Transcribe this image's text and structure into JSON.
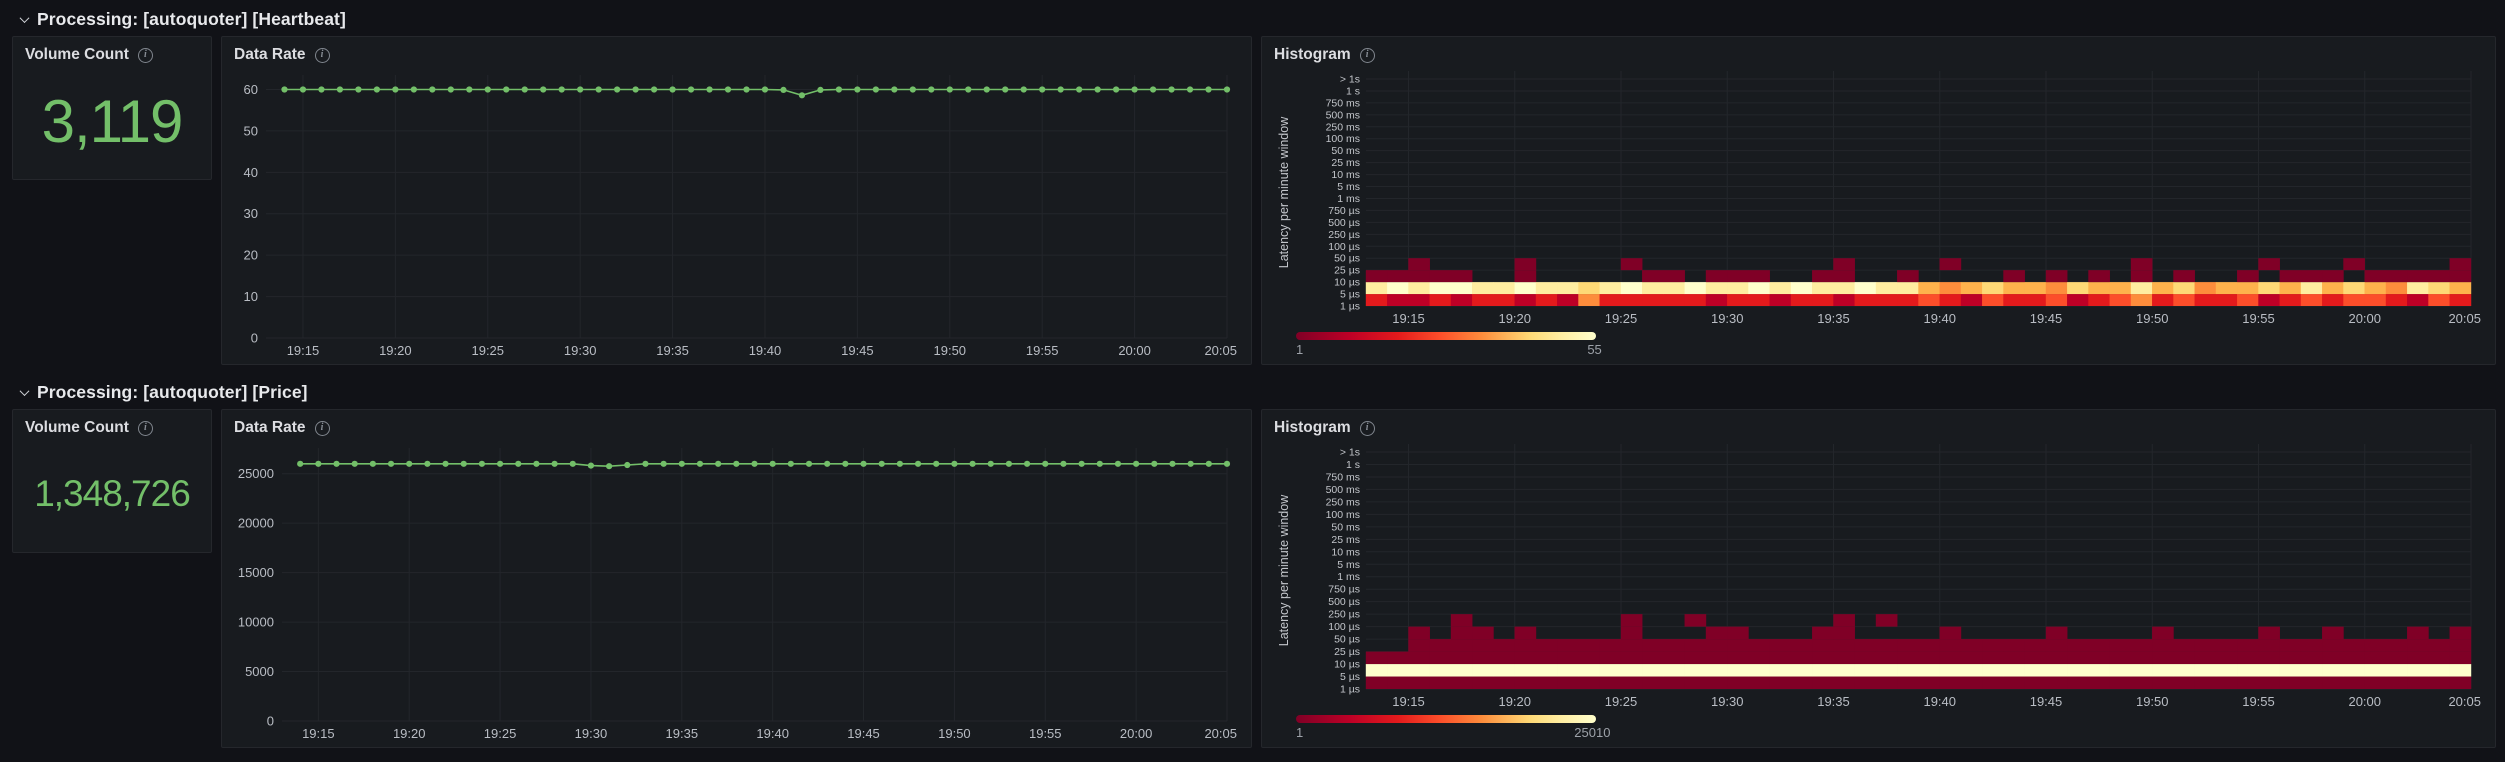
{
  "icons": {
    "row_collapse": "chevron-down",
    "panel_info": "info-circle"
  },
  "colors": {
    "page_bg": "#111217",
    "panel_bg": "#181b1f",
    "panel_border": "#25272c",
    "grid": "#23262b",
    "axis_text": "#b9bdc4",
    "bucket_text": "#c3c6cb",
    "green": "#73bf69",
    "heat_palette": [
      "#800026",
      "#bd0026",
      "#e31a1c",
      "#fc4e2a",
      "#fd8d3c",
      "#feb24c",
      "#fed976",
      "#ffeda0",
      "#ffffcc"
    ]
  },
  "rows": [
    {
      "title": "Processing: [autoquoter] [Heartbeat]",
      "stat": {
        "title": "Volume Count",
        "value": "3,119"
      },
      "rate": {
        "title": "Data Rate"
      },
      "hist": {
        "title": "Histogram",
        "legend_min": "1",
        "legend_max": "55"
      }
    },
    {
      "title": "Processing: [autoquoter] [Price]",
      "stat": {
        "title": "Volume Count",
        "value": "1,348,726"
      },
      "rate": {
        "title": "Data Rate"
      },
      "hist": {
        "title": "Histogram",
        "legend_min": "1",
        "legend_max": "25010"
      }
    }
  ],
  "chart_data": [
    {
      "id": "rate-heartbeat",
      "type": "line",
      "title": "Data Rate",
      "line_color": "#73bf69",
      "x_domain": 52,
      "x_offset": 1,
      "time_start": "19:13",
      "time_end": "20:05",
      "x_ticks": [
        "19:15",
        "19:20",
        "19:25",
        "19:30",
        "19:35",
        "19:40",
        "19:45",
        "19:50",
        "19:55",
        "20:00",
        "20:05"
      ],
      "x_tick_pos": [
        2,
        7,
        12,
        17,
        22,
        27,
        32,
        37,
        42,
        47,
        52
      ],
      "y_ticks": [
        0,
        10,
        20,
        30,
        40,
        50,
        60
      ],
      "ylim": [
        0,
        63.5
      ],
      "axis_width": 34,
      "values": [
        60,
        60,
        60,
        60,
        60,
        60,
        60,
        60,
        60,
        60,
        60,
        60,
        60,
        60,
        60,
        60,
        60,
        60,
        60,
        60,
        60,
        60,
        60,
        60,
        60,
        60,
        60,
        59.9,
        58.6,
        59.9,
        60,
        60,
        60,
        60,
        60,
        60,
        60,
        60,
        60,
        60,
        60,
        60,
        60,
        60,
        60,
        60,
        60,
        60,
        60,
        60,
        60,
        60
      ]
    },
    {
      "id": "hist-heartbeat",
      "type": "heatmap",
      "title": "Histogram",
      "ylabel": "Latency per minute window",
      "x_domain": 52,
      "time_start": "19:13",
      "time_end": "20:05",
      "x_ticks": [
        "19:15",
        "19:20",
        "19:25",
        "19:30",
        "19:35",
        "19:40",
        "19:45",
        "19:50",
        "19:55",
        "20:00",
        "20:05"
      ],
      "x_tick_pos": [
        2,
        7,
        12,
        17,
        22,
        27,
        32,
        37,
        42,
        47,
        52
      ],
      "y_buckets": [
        "> 1s",
        "1 s",
        "750 ms",
        "500 ms",
        "250 ms",
        "100 ms",
        "50 ms",
        "25 ms",
        "10 ms",
        "5 ms",
        "1 ms",
        "750 µs",
        "500 µs",
        "250 µs",
        "100 µs",
        "50 µs",
        "25 µs",
        "10 µs",
        "5 µs",
        "1 µs"
      ],
      "legend": {
        "min": 1,
        "max": 55
      },
      "bands": [
        {
          "bucket": "1µs-5µs",
          "level": 0,
          "cells": [
            "3223233232",
            "5333332332",
            "3323334324",
            "3342345343",
            "3423434432",
            "43"
          ]
        },
        {
          "bucket": "5µs-10µs",
          "level": 1,
          "cells": [
            "8989988988",
            "7898898898",
            "9889886567",
            "6657668675",
            "6676867658",
            "76"
          ]
        },
        {
          "bucket": "10µs-25µs",
          "level": 2,
          "cells": [
            "11111..1..",
            "...11.111.",
            ".11..1....",
            "1.1.1.1.1.",
            ".1.111.111",
            "11"
          ]
        },
        {
          "bucket": "25µs-50µs",
          "level": 3,
          "cells": [
            "..1....1..",
            "..1.......",
            "..1....1..",
            "......1...",
            "..1...1...",
            ".1"
          ]
        }
      ]
    },
    {
      "id": "rate-price",
      "type": "line",
      "title": "Data Rate",
      "line_color": "#73bf69",
      "x_domain": 52,
      "x_offset": 1,
      "time_start": "19:13",
      "time_end": "20:05",
      "x_ticks": [
        "19:15",
        "19:20",
        "19:25",
        "19:30",
        "19:35",
        "19:40",
        "19:45",
        "19:50",
        "19:55",
        "20:00",
        "20:05"
      ],
      "x_tick_pos": [
        2,
        7,
        12,
        17,
        22,
        27,
        32,
        37,
        42,
        47,
        52
      ],
      "y_ticks": [
        0,
        5000,
        10000,
        15000,
        20000,
        25000
      ],
      "ylim": [
        0,
        27600
      ],
      "axis_width": 50,
      "values": [
        26000,
        26000,
        26000,
        26000,
        26000,
        26000,
        26000,
        26000,
        26000,
        26000,
        26000,
        26000,
        26000,
        26000,
        26000,
        26000,
        25820,
        25760,
        25880,
        26000,
        26000,
        26000,
        26000,
        26000,
        26000,
        26000,
        26000,
        26000,
        26000,
        26000,
        26000,
        26000,
        26000,
        26000,
        26000,
        26000,
        26000,
        26000,
        26000,
        26000,
        26000,
        26000,
        26000,
        26000,
        26000,
        26000,
        26000,
        26000,
        26000,
        26000,
        26000,
        26000
      ]
    },
    {
      "id": "hist-price",
      "type": "heatmap",
      "title": "Histogram",
      "ylabel": "Latency per minute window",
      "x_domain": 52,
      "time_start": "19:13",
      "time_end": "20:05",
      "x_ticks": [
        "19:15",
        "19:20",
        "19:25",
        "19:30",
        "19:35",
        "19:40",
        "19:45",
        "19:50",
        "19:55",
        "20:00",
        "20:05"
      ],
      "x_tick_pos": [
        2,
        7,
        12,
        17,
        22,
        27,
        32,
        37,
        42,
        47,
        52
      ],
      "y_buckets": [
        "> 1s",
        "1 s",
        "750 ms",
        "500 ms",
        "250 ms",
        "100 ms",
        "50 ms",
        "25 ms",
        "10 ms",
        "5 ms",
        "1 ms",
        "750 µs",
        "500 µs",
        "250 µs",
        "100 µs",
        "50 µs",
        "25 µs",
        "10 µs",
        "5 µs",
        "1 µs"
      ],
      "legend": {
        "min": 1,
        "max": 25010
      },
      "bands": [
        {
          "bucket": "1µs-5µs",
          "level": 0,
          "cells": [
            "1111111111",
            "1111111111",
            "1111111111",
            "1111111111",
            "1111111111",
            "11"
          ]
        },
        {
          "bucket": "5µs-10µs",
          "level": 1,
          "cells": [
            "9999999999",
            "9999999999",
            "9999999999",
            "9999999999",
            "9999999999",
            "99"
          ]
        },
        {
          "bucket": "10µs-25µs",
          "level": 2,
          "cells": [
            "1111111111",
            "1111111111",
            "1111111111",
            "1111111111",
            "1111111111",
            "11"
          ]
        },
        {
          "bucket": "25µs-50µs",
          "level": 3,
          "cells": [
            "..11111111",
            "1111111111",
            "1111111111",
            "1111111111",
            "1111111111",
            "11"
          ]
        },
        {
          "bucket": "50µs-100µs",
          "level": 4,
          "cells": [
            "..1.11.1..",
            "..1...11..",
            ".11....1..",
            "..1....1..",
            "..1..1...1",
            ".1"
          ]
        },
        {
          "bucket": "100µs-250µs",
          "level": 5,
          "cells": [
            "....1.....",
            "..1..1....",
            "..1.1.....",
            "..........",
            "..........",
            ".."
          ]
        }
      ]
    }
  ]
}
